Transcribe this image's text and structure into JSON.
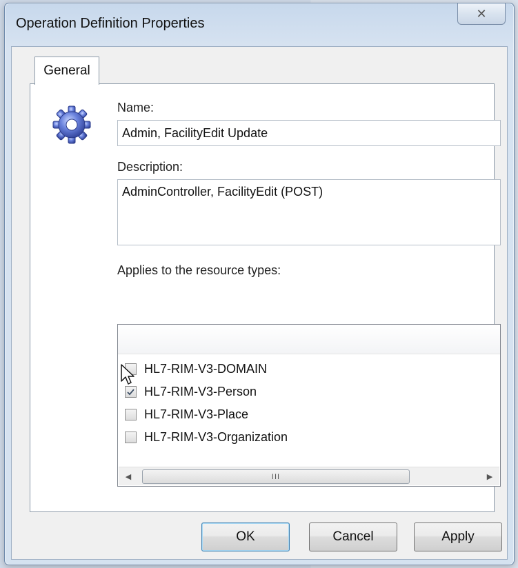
{
  "dialog": {
    "title": "Operation Definition Properties",
    "close_glyph": "✕"
  },
  "tabs": [
    {
      "label": "General",
      "selected": true
    }
  ],
  "general": {
    "icon": "gear-icon",
    "name_label": "Name:",
    "name_value": "Admin, FacilityEdit Update",
    "description_label": "Description:",
    "description_value": "AdminController, FacilityEdit (POST)",
    "resource_types_label": "Applies to the resource types:",
    "resource_types": [
      {
        "label": "HL7-RIM-V3-DOMAIN",
        "checked": false
      },
      {
        "label": "HL7-RIM-V3-Person",
        "checked": true
      },
      {
        "label": "HL7-RIM-V3-Place",
        "checked": false
      },
      {
        "label": "HL7-RIM-V3-Organization",
        "checked": false
      }
    ],
    "scrollbar": {
      "left_arrow": "◀",
      "right_arrow": "▶",
      "thumb_grip": "III"
    }
  },
  "buttons": {
    "ok": "OK",
    "cancel": "Cancel",
    "apply": "Apply"
  },
  "colors": {
    "accent": "#3c7fb1",
    "gear": "#3f58b8"
  }
}
